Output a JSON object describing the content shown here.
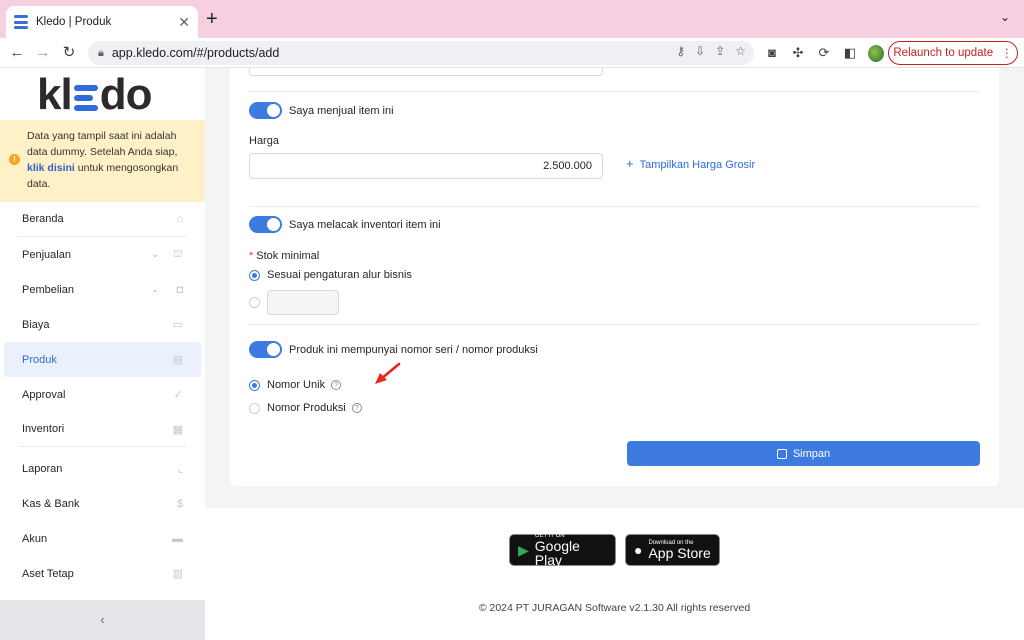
{
  "browser": {
    "tab_title": "Kledo | Produk",
    "tab_close": "✕",
    "new_tab": "+",
    "url": "app.kledo.com/#/products/add",
    "relaunch_label": "Relaunch to update"
  },
  "sidebar": {
    "logo": {
      "left": "kl",
      "right": "do"
    },
    "notice": {
      "text_before": "Data yang tampil saat ini adalah data dummy. Setelah Anda siap, ",
      "link": "klik disini",
      "text_after": " untuk mengosongkan data."
    },
    "items": [
      {
        "label": "Beranda",
        "icon": "home-icon"
      },
      {
        "label": "Penjualan",
        "icon": "basket-icon",
        "expandable": true
      },
      {
        "label": "Pembelian",
        "icon": "bag-icon",
        "expandable": true
      },
      {
        "label": "Biaya",
        "icon": "card-icon"
      },
      {
        "label": "Produk",
        "icon": "box-icon",
        "active": true
      },
      {
        "label": "Approval",
        "icon": "check-icon"
      },
      {
        "label": "Inventori",
        "icon": "warehouse-icon"
      },
      {
        "label": "Laporan",
        "icon": "chart-icon"
      },
      {
        "label": "Kas & Bank",
        "icon": "dollar-icon"
      },
      {
        "label": "Akun",
        "icon": "ledger-icon"
      },
      {
        "label": "Aset Tetap",
        "icon": "building-icon"
      }
    ],
    "collapse_icon": "‹"
  },
  "form": {
    "sell_toggle_label": "Saya menjual item ini",
    "price_label": "Harga",
    "price_value": "2.500.000",
    "wholesale_link": "Tampilkan Harga Grosir",
    "inventory_toggle_label": "Saya melacak inventori item ini",
    "min_stock_label": "Stok minimal",
    "min_stock_option_default": "Sesuai pengaturan alur bisnis",
    "serial_toggle_label": "Produk ini mempunyai nomor seri / nomor produksi",
    "serial_option_unique": "Nomor Unik",
    "serial_option_production": "Nomor Produksi",
    "help_glyph": "?",
    "save_label": "Simpan"
  },
  "footer": {
    "google_small": "GET IT ON",
    "google_big": "Google Play",
    "apple_small": "Download on the",
    "apple_big": "App Store",
    "copyright": "© 2024 PT JURAGAN Software v2.1.30 All rights reserved"
  },
  "colors": {
    "accent": "#3d7be0",
    "notice_bg": "#fff1c7",
    "relaunch": "#c5221f",
    "arrow": "#e8261c"
  }
}
